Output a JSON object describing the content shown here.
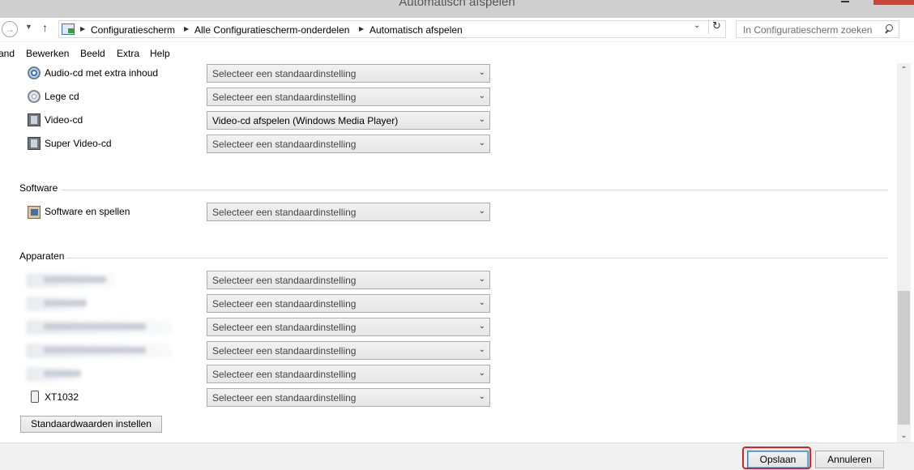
{
  "window": {
    "title": "Automatisch afspelen"
  },
  "addressbar": {
    "crumbs": [
      "Configuratiescherm",
      "Alle Configuratiescherm-onderdelen",
      "Automatisch afspelen"
    ],
    "search_placeholder": "In Configuratiescherm zoeken"
  },
  "menu": {
    "items": [
      "and",
      "Bewerken",
      "Beeld",
      "Extra",
      "Help"
    ]
  },
  "media_rows": [
    {
      "label": "Audio-cd met extra inhoud",
      "value": "Selecteer een standaardinstelling",
      "icon": "audio-cd-icon"
    },
    {
      "label": "Lege cd",
      "value": "Selecteer een standaardinstelling",
      "icon": "blank-cd-icon"
    },
    {
      "label": "Video-cd",
      "value": "Video-cd afspelen (Windows Media Player)",
      "icon": "video-cd-icon"
    },
    {
      "label": "Super Video-cd",
      "value": "Selecteer een standaardinstelling",
      "icon": "video-cd-icon"
    }
  ],
  "software": {
    "title": "Software",
    "rows": [
      {
        "label": "Software en spellen",
        "value": "Selecteer een standaardinstelling",
        "icon": "software-icon"
      }
    ]
  },
  "devices": {
    "title": "Apparaten",
    "rows": [
      {
        "label": "",
        "value": "Selecteer een standaardinstelling",
        "blurred": true
      },
      {
        "label": "",
        "value": "Selecteer een standaardinstelling",
        "blurred": true
      },
      {
        "label": "",
        "value": "Selecteer een standaardinstelling",
        "blurred": true
      },
      {
        "label": "",
        "value": "Selecteer een standaardinstelling",
        "blurred": true
      },
      {
        "label": "",
        "value": "Selecteer een standaardinstelling",
        "blurred": true
      },
      {
        "label": "XT1032",
        "value": "Selecteer een standaardinstelling",
        "icon": "phone-device-icon"
      }
    ]
  },
  "reset_button": "Standaardwaarden instellen",
  "footer": {
    "save": "Opslaan",
    "cancel": "Annuleren"
  },
  "colors": {
    "highlight": "#d9231f",
    "close_button": "#c7463a"
  }
}
